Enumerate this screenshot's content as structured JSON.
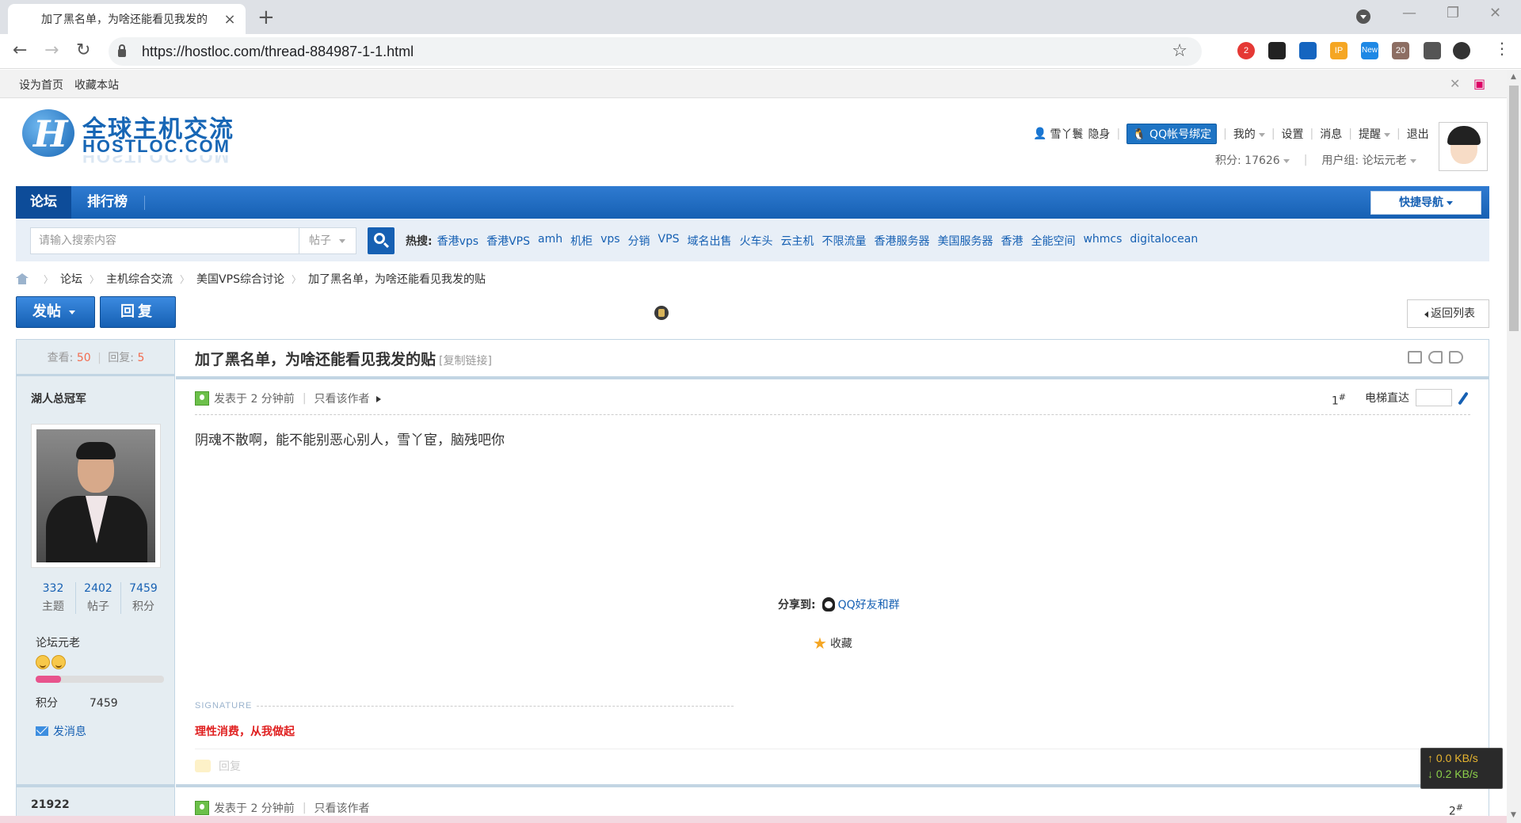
{
  "browser": {
    "tab_title": "加了黑名单，为啥还能看见我发的",
    "url": "https://hostloc.com/thread-884987-1-1.html",
    "extensions": [
      {
        "name": "adblock-icon",
        "badge": "2",
        "color": "#e53935"
      },
      {
        "name": "tampermonkey-icon",
        "badge": "",
        "color": "#222222"
      },
      {
        "name": "flag-icon",
        "badge": "",
        "color": "#1565c0"
      },
      {
        "name": "ip-icon",
        "badge": "IP",
        "color": "#f5a623"
      },
      {
        "name": "new-ext-icon",
        "badge": "New",
        "color": "#1e88e5"
      },
      {
        "name": "cookie-ext-icon",
        "badge": "20",
        "color": "#8d6e63"
      },
      {
        "name": "puzzle-icon",
        "badge": "",
        "color": "#555555"
      },
      {
        "name": "profile-icon",
        "badge": "",
        "color": "#333333"
      }
    ]
  },
  "sitebar": {
    "set_home": "设为首页",
    "bookmark": "收藏本站"
  },
  "header": {
    "logo_cn": "全球主机交流",
    "logo_en": "HOSTLOC.COM",
    "username": "雪丫鬟",
    "invisible": "隐身",
    "qq_bind": "QQ帐号绑定",
    "mine": "我的",
    "settings": "设置",
    "messages": "消息",
    "reminders": "提醒",
    "logout": "退出",
    "credits": "积分: 17626",
    "usergroup": "用户组: 论坛元老"
  },
  "nav": {
    "forum": "论坛",
    "ranking": "排行榜",
    "quick_nav": "快捷导航"
  },
  "search": {
    "placeholder": "请输入搜索内容",
    "type": "帖子",
    "hot_label": "热搜:",
    "hot_terms": [
      "香港vps",
      "香港VPS",
      "amh",
      "机柜",
      "vps",
      "分销",
      "VPS",
      "域名出售",
      "火车头",
      "云主机",
      "不限流量",
      "香港服务器",
      "美国服务器",
      "香港",
      "全能空间",
      "whmcs",
      "digitalocean"
    ]
  },
  "breadcrumb": [
    "论坛",
    "主机综合交流",
    "美国VPS综合讨论",
    "加了黑名单，为啥还能看见我发的贴"
  ],
  "actions": {
    "post": "发帖",
    "reply": "回复",
    "back": "返回列表"
  },
  "thread": {
    "views_label": "查看:",
    "views": "50",
    "replies_label": "回复:",
    "replies": "5",
    "title": "加了黑名单，为啥还能看见我发的贴",
    "copy_link": "[复制链接]"
  },
  "post1": {
    "author": "湖人总冠军",
    "stats": [
      {
        "value": "332",
        "label": "主题"
      },
      {
        "value": "2402",
        "label": "帖子"
      },
      {
        "value": "7459",
        "label": "积分"
      }
    ],
    "rank": "论坛元老",
    "progress": 0.2,
    "credits_label": "积分",
    "credits": "7459",
    "send_msg": "发消息",
    "posted": "发表于 2 分钟前",
    "only_author": "只看该作者",
    "floor": "1",
    "elevator": "电梯直达",
    "content": "阴魂不散啊，能不能别恶心别人，雪丫宦，脑残吧你",
    "share_label": "分享到:",
    "share_qq": "QQ好友和群",
    "favorite": "收藏",
    "signature_label": "SIGNATURE",
    "signature": "理性消费，从我做起",
    "reply": "回复"
  },
  "post2": {
    "author": "21922",
    "posted": "发表于 2 分钟前",
    "only_author": "只看该作者",
    "floor": "2"
  },
  "speed": {
    "up": "0.0 KB/s",
    "down": "0.2 KB/s"
  }
}
